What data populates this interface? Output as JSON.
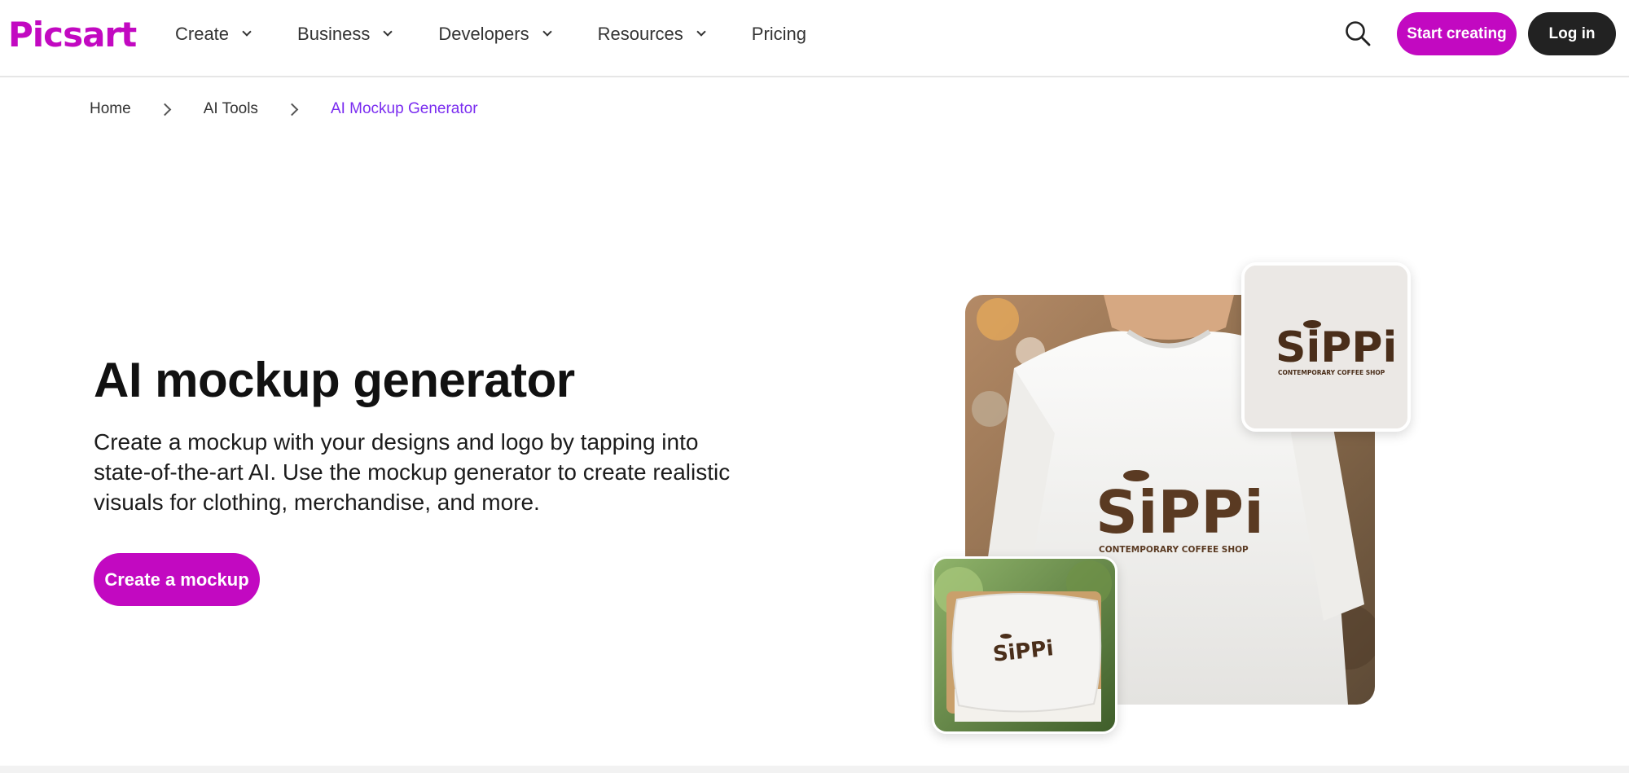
{
  "brand": {
    "name": "Picsart",
    "accent": "#c209c1",
    "dark": "#222222",
    "link_active": "#7a2cf0"
  },
  "header": {
    "nav": [
      {
        "label": "Create",
        "has_dropdown": true
      },
      {
        "label": "Business",
        "has_dropdown": true
      },
      {
        "label": "Developers",
        "has_dropdown": true
      },
      {
        "label": "Resources",
        "has_dropdown": true
      },
      {
        "label": "Pricing",
        "has_dropdown": false
      }
    ],
    "search_icon": "search-icon",
    "start_label": "Start creating",
    "login_label": "Log in"
  },
  "breadcrumb": [
    "Home",
    "AI Tools",
    "AI Mockup Generator"
  ],
  "hero": {
    "title": "AI mockup generator",
    "description": "Create a mockup with your designs and logo by tapping into state-of-the-art AI. Use the mockup generator to create realistic visuals for clothing, merchandise, and more.",
    "cta_label": "Create a mockup"
  },
  "collage": {
    "logo_word": "SiPPi",
    "logo_tagline": "CONTEMPORARY COFFEE SHOP"
  }
}
